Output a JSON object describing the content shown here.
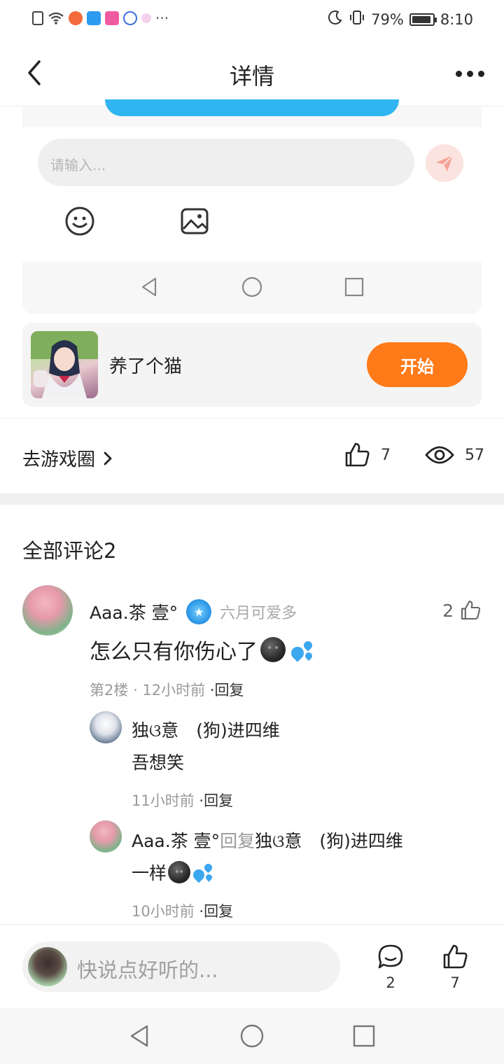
{
  "status_bar": {
    "battery_percent": "79%",
    "time": "8:10",
    "battery_level": 0.79,
    "overflow": "···"
  },
  "header": {
    "title": "详情"
  },
  "embedded_screen": {
    "input_placeholder": "请输入..."
  },
  "game_card": {
    "name": "养了个猫",
    "start_label": "开始"
  },
  "stats": {
    "goto_label": "去游戏圈",
    "like_count": "7",
    "view_count": "57"
  },
  "comments": {
    "title": "全部评论2",
    "items": [
      {
        "user": "Aaa.茶 壹°",
        "badge": "六月可爱多",
        "like_count": "2",
        "text": "怎么只有你伤心了",
        "floor": "第2楼",
        "time": "12小时前",
        "reply_label": "·回复"
      }
    ],
    "replies": [
      {
        "user": "独ଓ意　(狗)进四维",
        "text": "吾想笑",
        "time": "11小时前",
        "reply_label": "·回复"
      },
      {
        "user": "Aaa.茶 壹°",
        "reply_word": "回复",
        "target": "独ଓ意　(狗)进四维",
        "text": "一样",
        "time": "10小时前",
        "reply_label": "·回复"
      }
    ]
  },
  "bottom_bar": {
    "placeholder": "快说点好听的...",
    "comment_count": "2",
    "like_count": "7"
  },
  "colors": {
    "accent_orange": "#ff7a18",
    "blue": "#2fb6f0"
  }
}
